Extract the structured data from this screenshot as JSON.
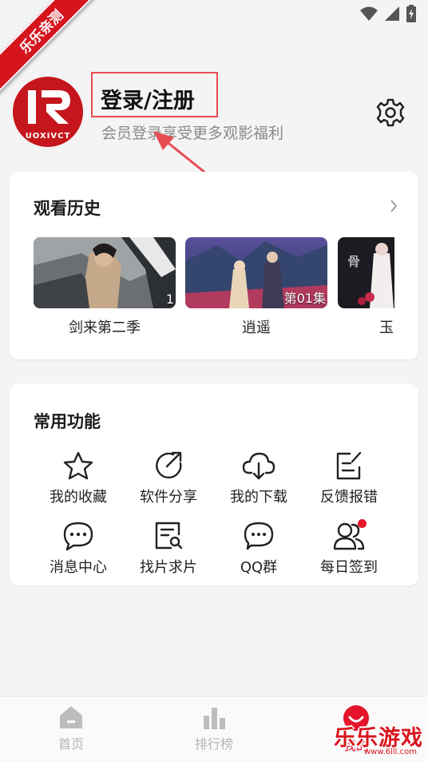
{
  "watermark": {
    "ribbon_text": "乐乐亲测",
    "corner_text": "乐乐游戏",
    "corner_url": "www.6lll.com"
  },
  "header": {
    "avatar_text": "UOXIVCT",
    "login_label": "登录/注册",
    "login_subtitle": "会员登录享受更多观影福利",
    "settings_icon": "gear-icon"
  },
  "history": {
    "title": "观看历史",
    "more_icon": "chevron-right-icon",
    "items": [
      {
        "title": "剑来第二季",
        "badge": "1"
      },
      {
        "title": "逍遥",
        "badge": "第01集"
      },
      {
        "title": "玉",
        "badge": ""
      }
    ]
  },
  "functions": {
    "title": "常用功能",
    "items": [
      {
        "label": "我的收藏",
        "icon": "star-icon"
      },
      {
        "label": "软件分享",
        "icon": "share-icon"
      },
      {
        "label": "我的下载",
        "icon": "cloud-download-icon"
      },
      {
        "label": "反馈报错",
        "icon": "feedback-edit-icon"
      },
      {
        "label": "消息中心",
        "icon": "message-icon"
      },
      {
        "label": "找片求片",
        "icon": "search-document-icon"
      },
      {
        "label": "QQ群",
        "icon": "chat-bubble-icon"
      },
      {
        "label": "每日签到",
        "icon": "users-icon"
      }
    ]
  },
  "bottom_nav": {
    "items": [
      {
        "label": "首页",
        "icon": "home-icon"
      },
      {
        "label": "排行榜",
        "icon": "bar-chart-icon"
      },
      {
        "label": "我的",
        "icon": "profile-icon"
      }
    ],
    "active_color": "#e5152b",
    "inactive_color": "#b4b4b4"
  },
  "colors": {
    "brand_red": "#c5161d",
    "highlight_border": "#e84c53",
    "background": "#f4f4f4"
  }
}
